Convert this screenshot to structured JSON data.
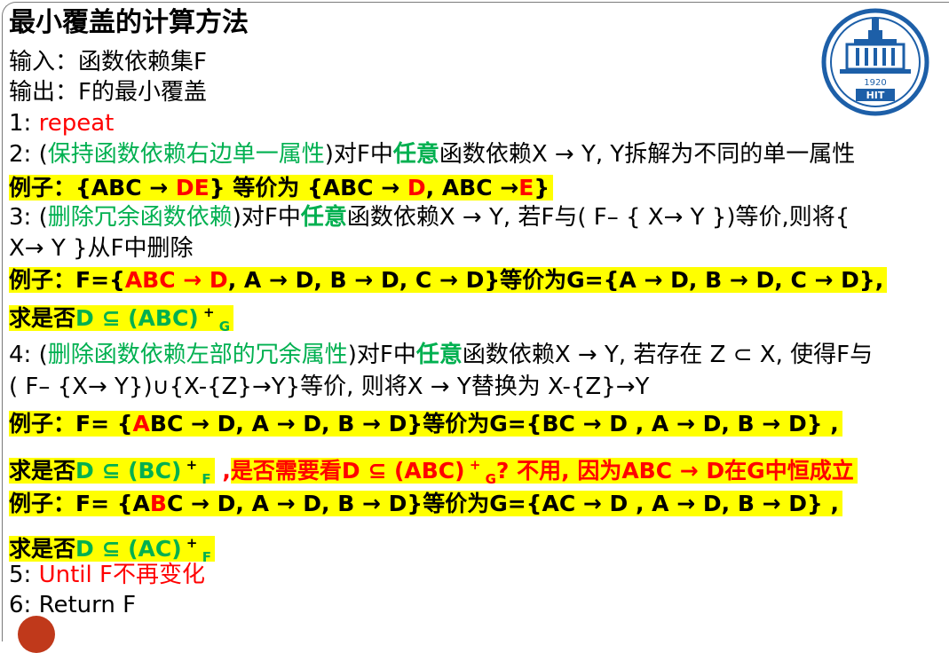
{
  "title": "最小覆盖的计算方法",
  "input_line": "输入：函数依赖集F",
  "output_line": "输出：F的最小覆盖",
  "step1": {
    "num": "1: ",
    "text": "repeat"
  },
  "step2": {
    "prefix": "2: (",
    "green": "保持函数依赖右边单一属性",
    "mid": ")对F中",
    "bold_green": "任意",
    "rest": "函数依赖X → Y, Y拆解为不同的单一属性"
  },
  "ex1": {
    "a": "例子：{ABC → ",
    "red1": "DE",
    "b": "} 等价为 {ABC → ",
    "red2": "D",
    "c": ", ABC →",
    "red3": "E",
    "d": "}"
  },
  "step3": {
    "prefix": "3: (",
    "green": "删除冗余函数依赖",
    "mid": ")对F中",
    "bold_green": "任意",
    "rest": "函数依赖X → Y, 若F与( F– { X→ Y })等价,则将{",
    "cont": "X→ Y }从F中删除"
  },
  "ex2": {
    "a": "例子：F={",
    "red": "ABC → D",
    "b": ", A → D, B → D, C → D}等价为G={A → D, B → D, C → D},",
    "q_a": "求是否",
    "q_green": "D ⊆ (ABC)",
    "q_sup": " + ",
    "q_sub": "G"
  },
  "step4": {
    "prefix": "4: (",
    "green": "删除函数依赖左部的冗余属性",
    "mid": ")对F中",
    "bold_green": "任意",
    "rest": "函数依赖X → Y, 若存在 Z ⊂ X, 使得F与",
    "cont": "( F– {X→ Y})∪{X-{Z}→Y}等价, 则将X → Y替换为 X-{Z}→Y"
  },
  "ex3": {
    "a": "例子：F= {",
    "red": "A",
    "b": "BC → D, A → D, B → D}等价为G={BC → D , A → D, B → D} ,",
    "q_a": "求是否",
    "q_green": "D ⊆ (BC)",
    "q_sup": " + ",
    "q_sub": "F",
    "q_sep": " ,",
    "q_red1": "是否需要看",
    "q_red2": "D ⊆ (ABC)",
    "q_red_sup": " + ",
    "q_red_sub": "G",
    "q_red3": "? 不用, 因为ABC → D在G中恒成立"
  },
  "ex4": {
    "a": "例子：F= {A",
    "red": "B",
    "b": "C → D, A → D, B → D}等价为G={AC → D , A → D, B → D} ,",
    "q_a": "求是否",
    "q_green": "D ⊆ (AC)",
    "q_sup": " + ",
    "q_sub": "F"
  },
  "step5": {
    "num": "5: ",
    "text": "Until F不再变化"
  },
  "step6": {
    "text": "6: Return F"
  },
  "logo": {
    "year": "1920",
    "letters": "HIT"
  },
  "colors": {
    "highlight": "#ffff00",
    "red": "#ff0000",
    "green": "#00b050"
  }
}
